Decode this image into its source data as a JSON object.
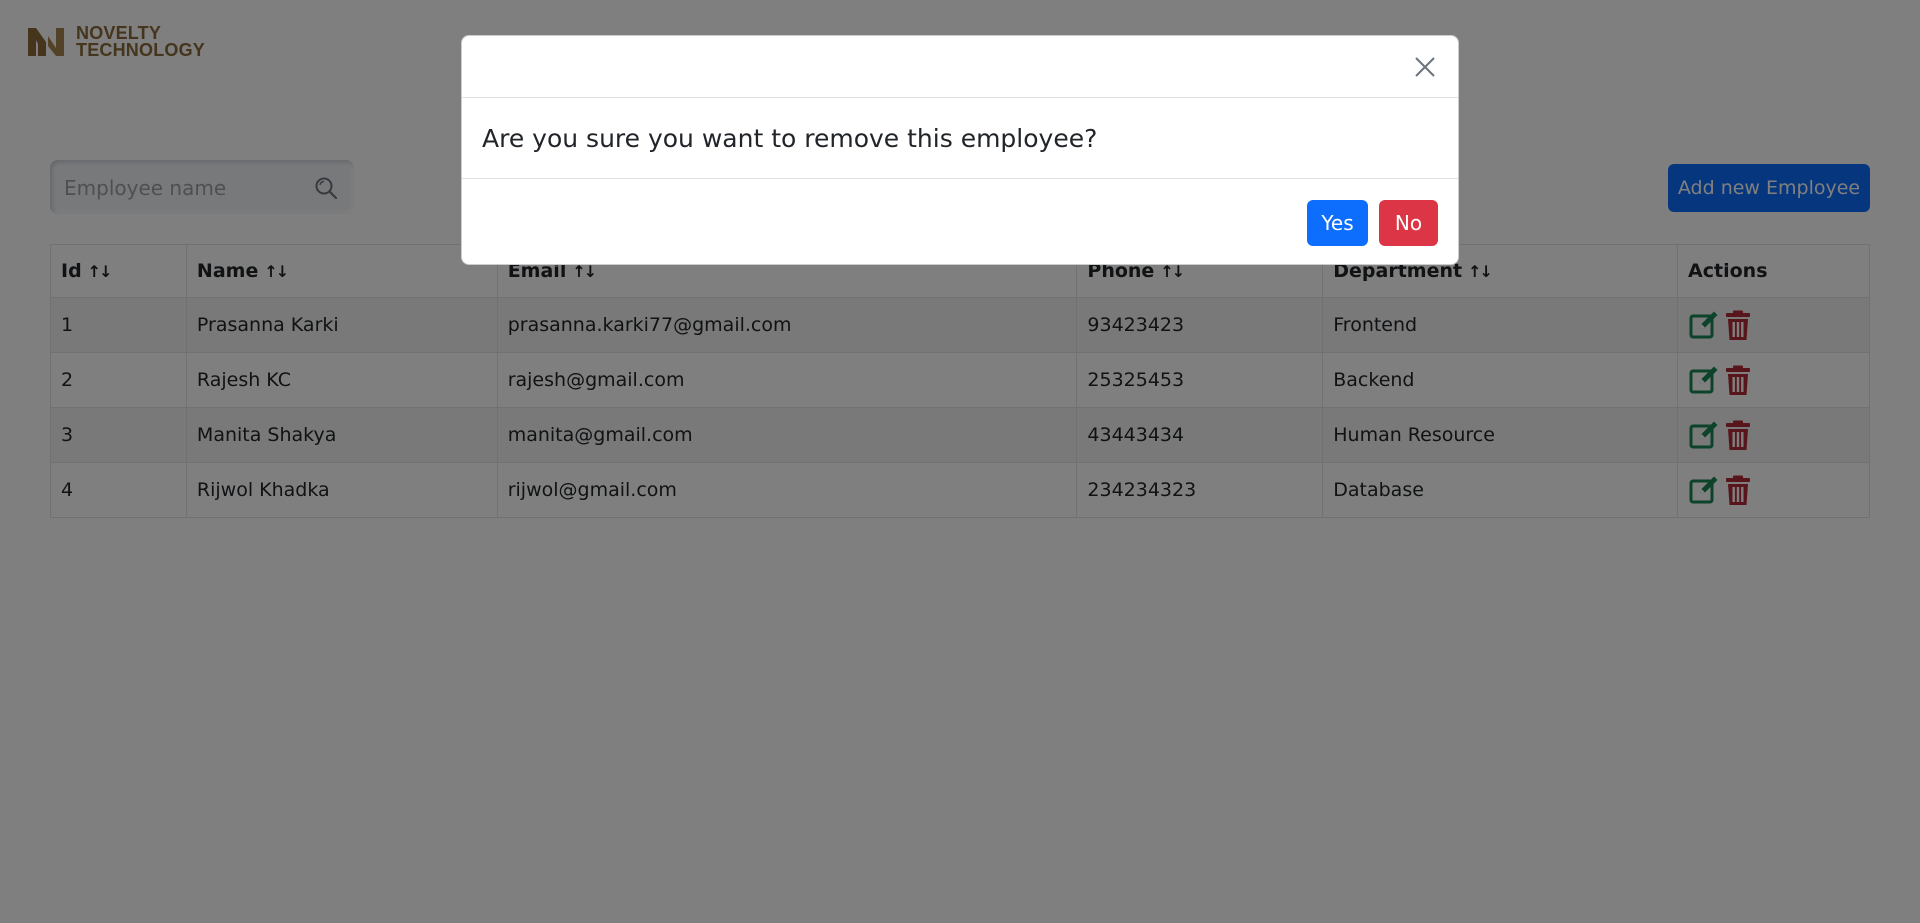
{
  "brand": {
    "line1": "NOVELTY",
    "line2": "TECHNOLOGY",
    "color": "#8a6a3a"
  },
  "search": {
    "placeholder": "Employee name",
    "value": ""
  },
  "toolbar": {
    "add_label": "Add new Employee"
  },
  "table": {
    "columns": [
      {
        "label": "Id",
        "sortable": true
      },
      {
        "label": "Name",
        "sortable": true
      },
      {
        "label": "Email",
        "sortable": true
      },
      {
        "label": "Phone",
        "sortable": true
      },
      {
        "label": "Department",
        "sortable": true
      },
      {
        "label": "Actions",
        "sortable": false
      }
    ],
    "sort_glyph": "↑↓",
    "rows": [
      {
        "id": "1",
        "name": "Prasanna Karki",
        "email": "prasanna.karki77@gmail.com",
        "phone": "93423423",
        "department": "Frontend"
      },
      {
        "id": "2",
        "name": "Rajesh KC",
        "email": "rajesh@gmail.com",
        "phone": "25325453",
        "department": "Backend"
      },
      {
        "id": "3",
        "name": "Manita Shakya",
        "email": "manita@gmail.com",
        "phone": "43443434",
        "department": "Human Resource"
      },
      {
        "id": "4",
        "name": "Rijwol Khadka",
        "email": "rijwol@gmail.com",
        "phone": "234234323",
        "department": "Database"
      }
    ]
  },
  "modal": {
    "message": "Are you sure you want to remove this employee?",
    "yes_label": "Yes",
    "no_label": "No"
  },
  "colors": {
    "primary": "#0d6efd",
    "danger": "#dc3545",
    "edit_icon": "#198754",
    "delete_icon": "#b02a37"
  },
  "icons": {
    "edit": "edit-icon",
    "delete": "trash-icon",
    "search": "search-icon",
    "close": "close-icon"
  }
}
